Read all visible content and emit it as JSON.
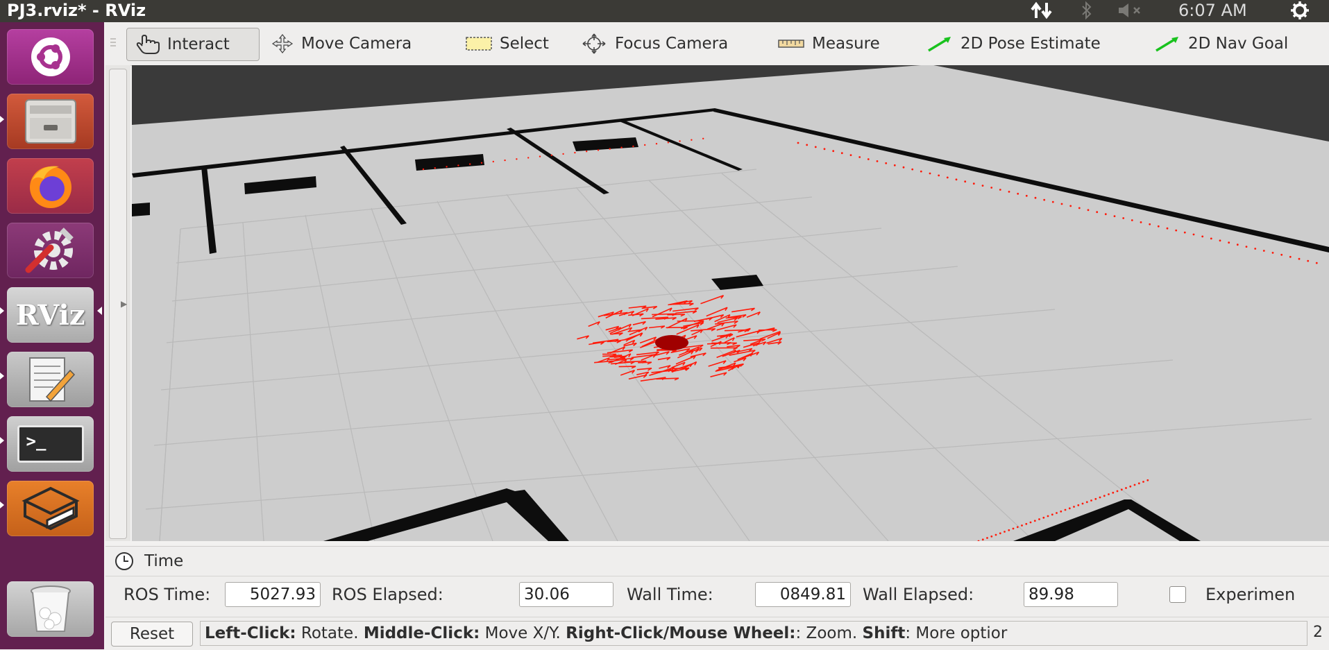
{
  "window": {
    "title": "PJ3.rviz* - RViz"
  },
  "panel": {
    "clock": "6:07 AM",
    "icons": [
      "network-icon",
      "bluetooth-icon",
      "volume-muted-icon",
      "settings-gear-icon"
    ]
  },
  "launcher": {
    "items": [
      {
        "name": "ubuntu-dash-icon"
      },
      {
        "name": "files-icon"
      },
      {
        "name": "firefox-icon"
      },
      {
        "name": "system-settings-icon"
      },
      {
        "name": "rviz-icon",
        "label": "RViz"
      },
      {
        "name": "text-editor-icon"
      },
      {
        "name": "terminal-icon",
        "label": ">_"
      },
      {
        "name": "gazebo-icon"
      },
      {
        "name": "trash-icon"
      }
    ]
  },
  "toolbar": {
    "tools": [
      {
        "label": "Interact",
        "icon": "hand-pointer-icon",
        "active": true
      },
      {
        "label": "Move Camera",
        "icon": "move-camera-icon",
        "active": false
      },
      {
        "label": "Select",
        "icon": "select-rect-icon",
        "active": false
      },
      {
        "label": "Focus Camera",
        "icon": "focus-camera-icon",
        "active": false
      },
      {
        "label": "Measure",
        "icon": "ruler-icon",
        "active": false
      },
      {
        "label": "2D Pose Estimate",
        "icon": "green-arrow-icon",
        "active": false
      },
      {
        "label": "2D Nav Goal",
        "icon": "green-arrow-icon",
        "active": false
      }
    ]
  },
  "viewport": {
    "description": "3D map view: gray occupancy grid floor with black walls and red particle cloud arrows",
    "colors": {
      "floor": "#cdcdcd",
      "unknown": "#3a3a3a",
      "walls": "#0d0d0d",
      "particles": "#ff1a0a"
    }
  },
  "time_panel": {
    "title": "Time",
    "ros_time_label": "ROS Time:",
    "ros_time_value": "5027.93",
    "ros_elapsed_label": "ROS Elapsed:",
    "ros_elapsed_value": "30.06",
    "wall_time_label": "Wall Time:",
    "wall_time_value": "0849.81",
    "wall_elapsed_label": "Wall Elapsed:",
    "wall_elapsed_value": "89.98",
    "experimental_label": "Experimen"
  },
  "status": {
    "reset_label": "Reset",
    "hint": {
      "left_click_key": "Left-Click:",
      "left_click_text": " Rotate. ",
      "middle_click_key": "Middle-Click:",
      "middle_click_text": " Move X/Y. ",
      "right_click_key": "Right-Click/Mouse Wheel:",
      "right_click_text": ": Zoom. ",
      "shift_key": "Shift",
      "shift_text": ": More optior"
    },
    "fps": "2"
  }
}
